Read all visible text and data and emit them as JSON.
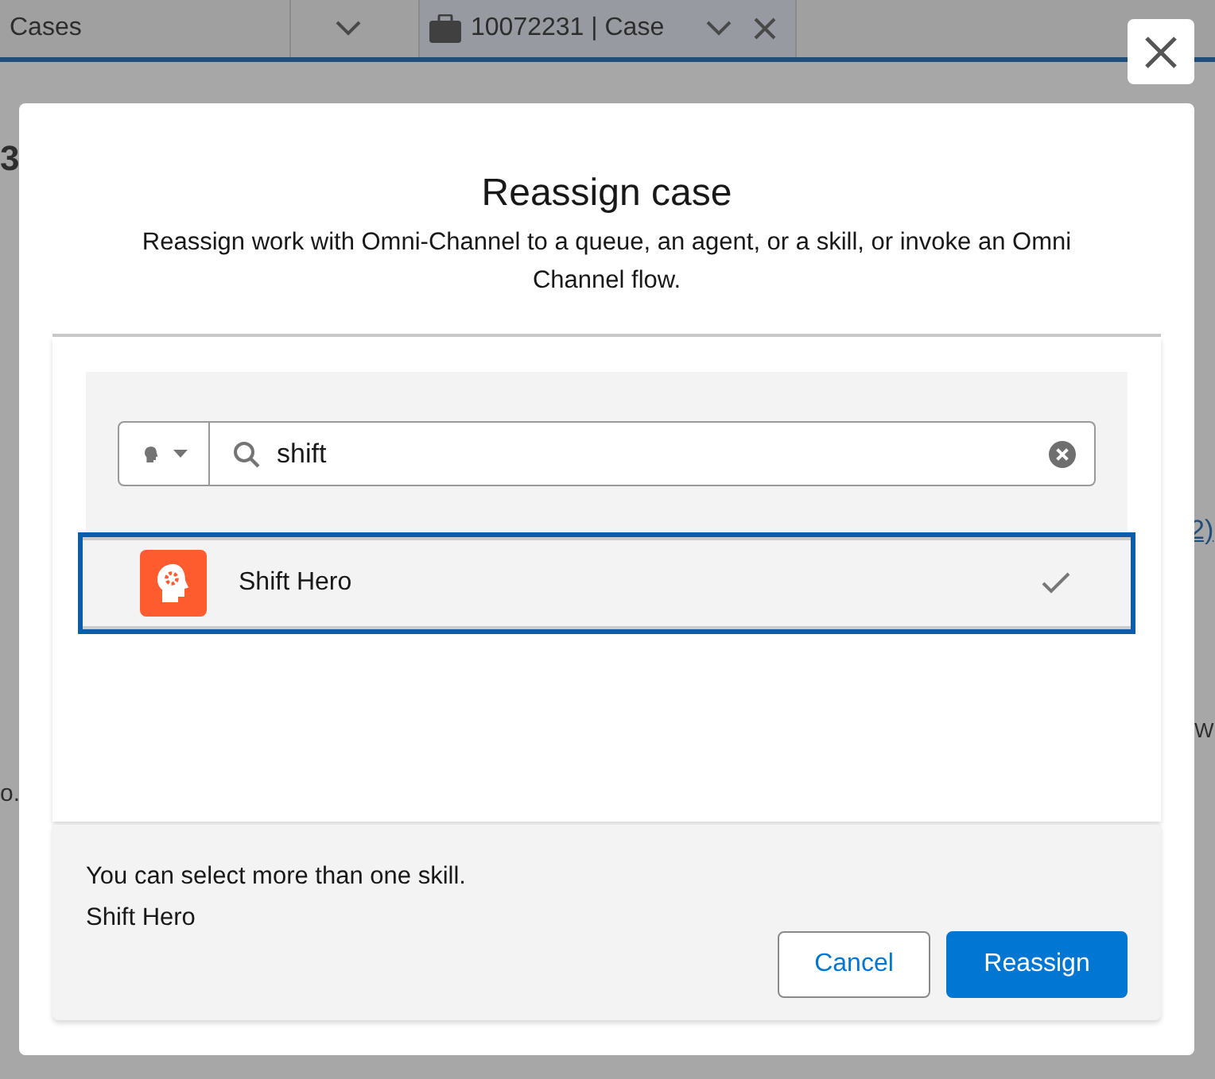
{
  "background": {
    "tabs": [
      {
        "label": "Cases",
        "selected": false
      },
      {
        "label": "10072231 | Case",
        "selected": true
      }
    ],
    "fragments": [
      "3",
      "2)",
      "W",
      "o."
    ]
  },
  "modal": {
    "title": "Reassign case",
    "description": "Reassign work with Omni-Channel to a queue, an agent, or a skill, or invoke an Omni Channel flow.",
    "search": {
      "value": "shift"
    },
    "results": [
      {
        "label": "Shift Hero",
        "selected": true
      }
    ],
    "hint": "You can select more than one skill.",
    "selection": "Shift Hero",
    "buttons": [
      {
        "label": "Cancel",
        "kind": "neutral"
      },
      {
        "label": "Reassign",
        "kind": "brand"
      }
    ]
  }
}
